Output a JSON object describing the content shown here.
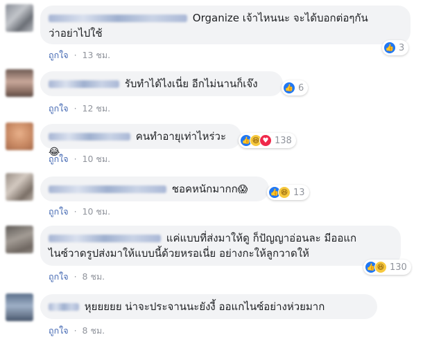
{
  "comments": [
    {
      "text_l1": "Organize เจ้าไหนนะ จะได้บอกต่อๆกัน",
      "text_l2": "ว่าอย่าไปใช้",
      "emoji": "",
      "react_count": "3",
      "like_label": "ถูกใจ",
      "time": "13 ชม."
    },
    {
      "text_l1": "รับทำได้ไงเนี่ย อีกไม่นานก็เจ๊ง",
      "text_l2": "",
      "emoji": "",
      "react_count": "6",
      "like_label": "ถูกใจ",
      "time": "12 ชม."
    },
    {
      "text_l1": "คนทำอายุเท่าไหร่วะ",
      "text_l2": "",
      "emoji": "😂",
      "react_count": "138",
      "like_label": "ถูกใจ",
      "time": "10 ชม."
    },
    {
      "text_l1": "ชอคหนักมากก",
      "text_l2": "",
      "emoji": "😱",
      "react_count": "13",
      "like_label": "ถูกใจ",
      "time": "10 ชม."
    },
    {
      "text_l1": "แค่แบบที่ส่งมาให้ดู ก็ปัญญาอ่อนละ มีออแก",
      "text_l2": "ไนซ์วาดรูปส่งมาให้แบบนี้ด้วยหรอเนี่ย อย่างกะให้ลูกวาดให้",
      "emoji": "",
      "react_count": "130",
      "like_label": "ถูกใจ",
      "time": "8 ชม."
    },
    {
      "text_l1": "หุยยยยย น่าจะประจานนะยังงี้ ออแกไนซ์อย่างห่วยมาก",
      "text_l2": "",
      "emoji": "",
      "react_count": "",
      "like_label": "ถูกใจ",
      "time": "8 ชม."
    }
  ],
  "separator": "·",
  "reaction_colors": {
    "like": "#2078f4",
    "haha": "#f7c93e",
    "love": "#f0284a"
  }
}
